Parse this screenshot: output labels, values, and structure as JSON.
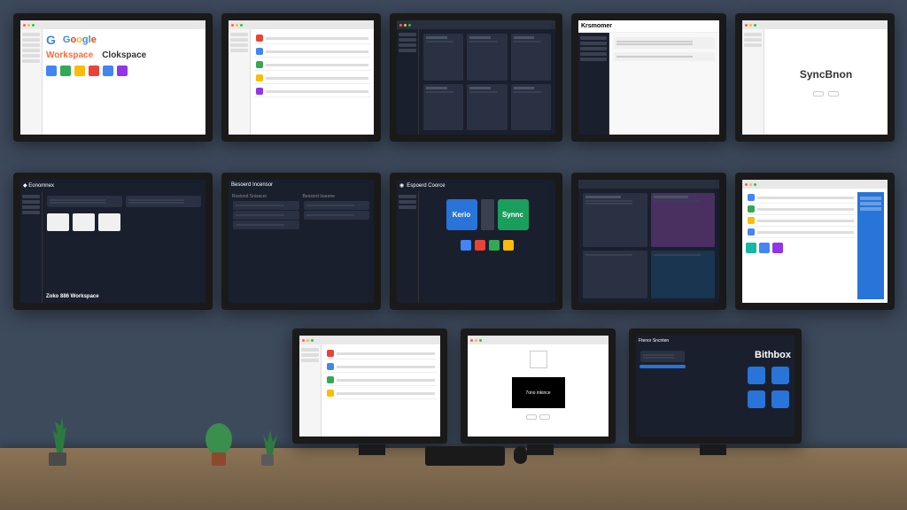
{
  "monitors": {
    "m1": {
      "brand": "Google",
      "sub": "Workspace",
      "sub2": "Clokspace"
    },
    "m4": {
      "brand": "Krsmomer"
    },
    "m5": {
      "brand": "SyncBnon"
    },
    "m6": {
      "footer": "Zoko 886 Workspace"
    },
    "m7": {
      "title": "Besoerd Incensor",
      "col1": "Rosiond Snisacer",
      "col2": "Bessord Isarene"
    },
    "m8": {
      "title": "Espoerd Coorce",
      "logo1": "Kerio",
      "logo2": "Synnc"
    },
    "m11": {
      "tag": "7ono inkince"
    },
    "m13": {
      "brand": "Bithbox",
      "title": "Ftenor Sncnten"
    }
  }
}
